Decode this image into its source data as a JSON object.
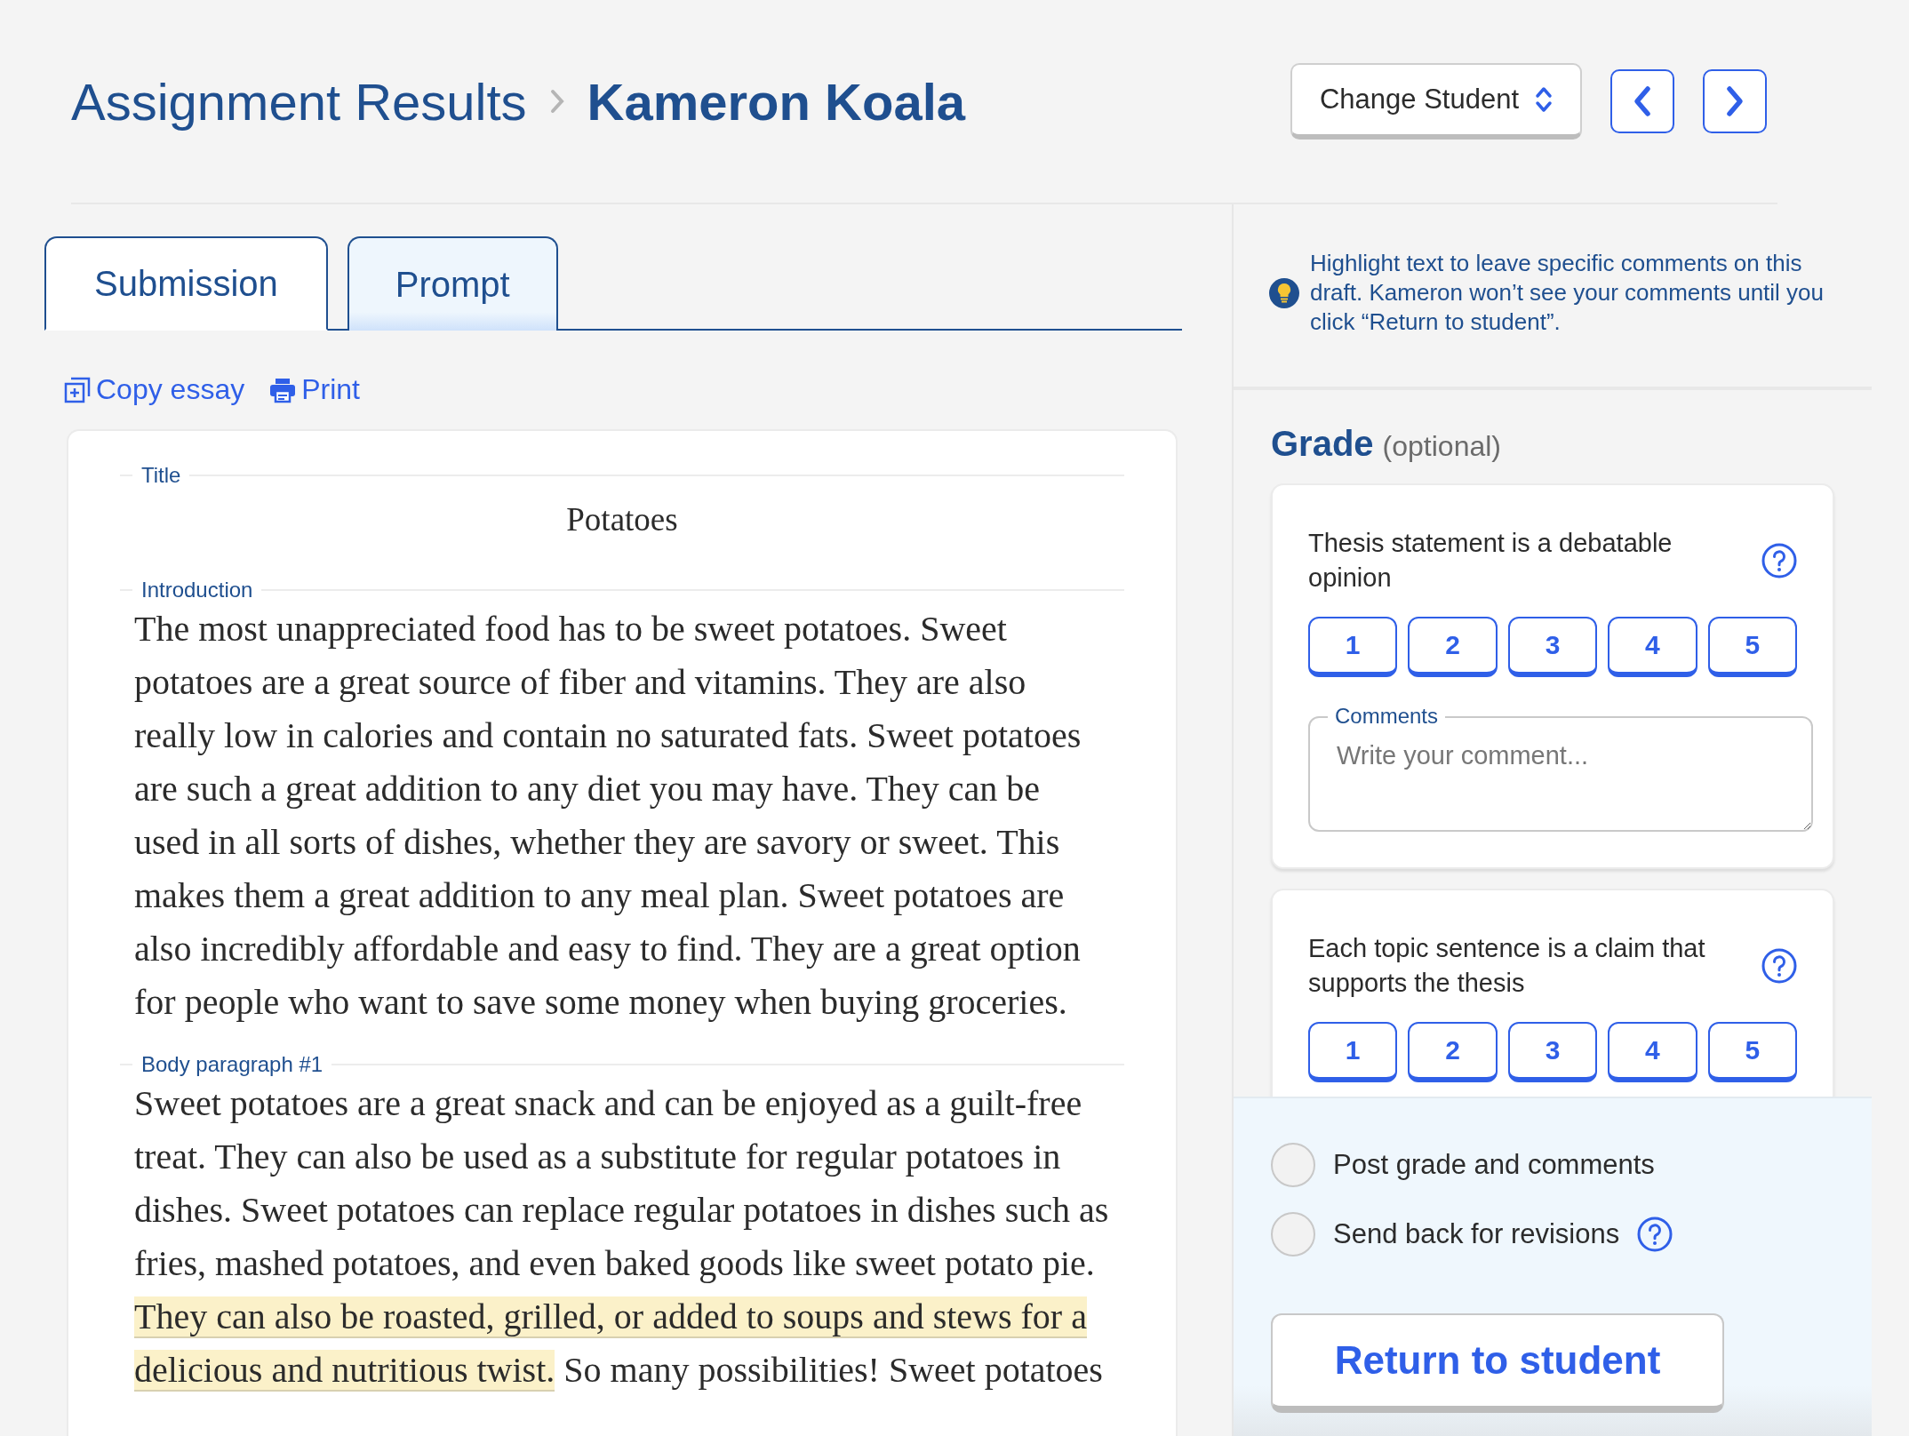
{
  "header": {
    "breadcrumb": "Assignment Results",
    "student": "Kameron Koala",
    "change_student": "Change Student"
  },
  "tabs": [
    {
      "label": "Submission",
      "selected": true
    },
    {
      "label": "Prompt",
      "selected": false
    }
  ],
  "actions": [
    {
      "kind": "copy",
      "label": "Copy essay"
    },
    {
      "kind": "print",
      "label": "Print"
    }
  ],
  "essay": [
    {
      "kind": "title",
      "label": "Title",
      "segments": [
        {
          "text": "Potatoes",
          "highlighted": false
        }
      ]
    },
    {
      "kind": "paragraph",
      "label": "Introduction",
      "segments": [
        {
          "text": "The most unappreciated food has to be sweet potatoes. Sweet potatoes are a great source of fiber and vitamins. They are also really low in calories and contain no saturated fats. Sweet potatoes are such a great addition to any diet you may have. They can be used in all sorts of dishes, whether they are savory or sweet. This makes them a great addition to any meal plan. Sweet potatoes are also incredibly affordable and easy to find. They are a great option for people who want to save some money when buying groceries.",
          "highlighted": false
        }
      ]
    },
    {
      "kind": "paragraph",
      "label": "Body paragraph #1",
      "segments": [
        {
          "text": "Sweet potatoes are a great snack and can be enjoyed as a guilt-free treat. They can also be used as a substitute for regular potatoes in dishes. Sweet potatoes can replace regular potatoes in dishes such as fries, mashed potatoes, and even baked goods like sweet potato pie. ",
          "highlighted": false
        },
        {
          "text": "They can also be roasted, grilled, or added to soups and stews for a delicious and nutritious twist.",
          "highlighted": true
        },
        {
          "text": " So many possibilities! Sweet potatoes",
          "highlighted": false
        }
      ]
    }
  ],
  "tip": "Highlight text to leave specific comments on this draft. Kameron won’t see your comments until you click “Return to student”.",
  "grade": {
    "heading": "Grade",
    "note": "(optional)",
    "criteria": [
      {
        "title": "Thesis statement is a debatable opinion",
        "scores": [
          {
            "label": "1",
            "selected": false
          },
          {
            "label": "2",
            "selected": false
          },
          {
            "label": "3",
            "selected": false
          },
          {
            "label": "4",
            "selected": false
          },
          {
            "label": "5",
            "selected": false
          }
        ],
        "comments": {
          "label": "Comments",
          "placeholder": "Write your comment..."
        }
      },
      {
        "title": "Each topic sentence is a claim that supports the thesis",
        "scores": [
          {
            "label": "1",
            "selected": false
          },
          {
            "label": "2",
            "selected": false
          },
          {
            "label": "3",
            "selected": false
          },
          {
            "label": "4",
            "selected": false
          },
          {
            "label": "5",
            "selected": false
          }
        ]
      }
    ]
  },
  "options": [
    {
      "label": "Post grade and comments",
      "selected": false,
      "help": false
    },
    {
      "label": "Send back for revisions",
      "selected": false,
      "help": true
    }
  ],
  "submit": "Return to student"
}
